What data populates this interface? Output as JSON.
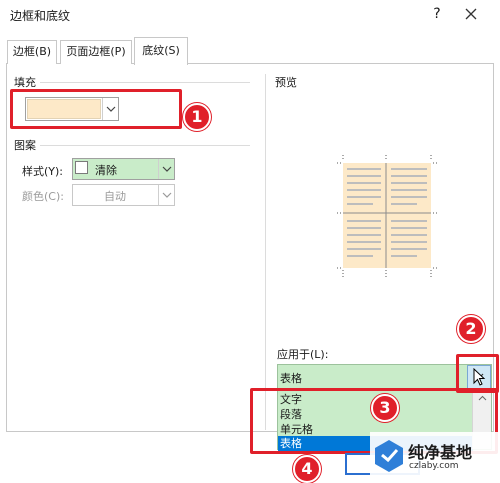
{
  "window": {
    "title": "边框和底纹",
    "help": "?"
  },
  "tabs": [
    {
      "label": "边框(B)"
    },
    {
      "label": "页面边框(P)"
    },
    {
      "label": "底纹(S)"
    }
  ],
  "fill": {
    "label": "填充",
    "color": "#fde9c8"
  },
  "pattern": {
    "label": "图案",
    "style_label": "样式(Y):",
    "style_value": "清除",
    "color_label": "颜色(C):",
    "color_value": "自动"
  },
  "preview": {
    "label": "预览"
  },
  "apply": {
    "label": "应用于(L):",
    "value": "表格",
    "options": [
      "文字",
      "段落",
      "单元格",
      "表格"
    ],
    "selected": "表格"
  },
  "badges": [
    "1",
    "2",
    "3",
    "4"
  ],
  "colors": {
    "highlight": "#e0202a",
    "selection": "#0078d7",
    "green": "#c9ecc9"
  },
  "watermark": {
    "title": "纯净基地",
    "url": "czlaby.com"
  }
}
